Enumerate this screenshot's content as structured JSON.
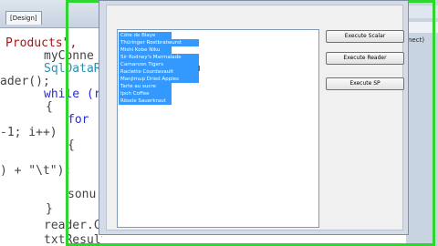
{
  "editor": {
    "tab_label": "[Design]",
    "tab_close": "x",
    "lines": [
      "Products\",",
      "myConne",
      "SqlDataRe",
      "ader();",
      "while (re",
      "{",
      "for (",
      "-1; i++)",
      "{",
      ") + \"\\t\");",
      "",
      "sonu",
      "}",
      "reader.Cl",
      "txtResult"
    ]
  },
  "right_pane": {
    "text": "nect)"
  },
  "dialog": {
    "list_items": [
      "Côte de Blaye",
      "Thüringer Rostbratwurst",
      "Mishi Kobe Niku",
      "Sir Rodney's Marmalade",
      "Carnarvon Tigers",
      "Raclette Courdavault",
      "Manjimup Dried Apples",
      "Tarte au sucre",
      "Ipoh Coffee",
      "Rössle Sauerkraut"
    ],
    "buttons": {
      "scalar": "Execute Scalar",
      "reader": "Execute Reader",
      "sp": "Execute SP"
    }
  },
  "colors": {
    "highlight": "#3399ff",
    "frame": "#2fd62f",
    "keyword": "#2b2bd6"
  }
}
